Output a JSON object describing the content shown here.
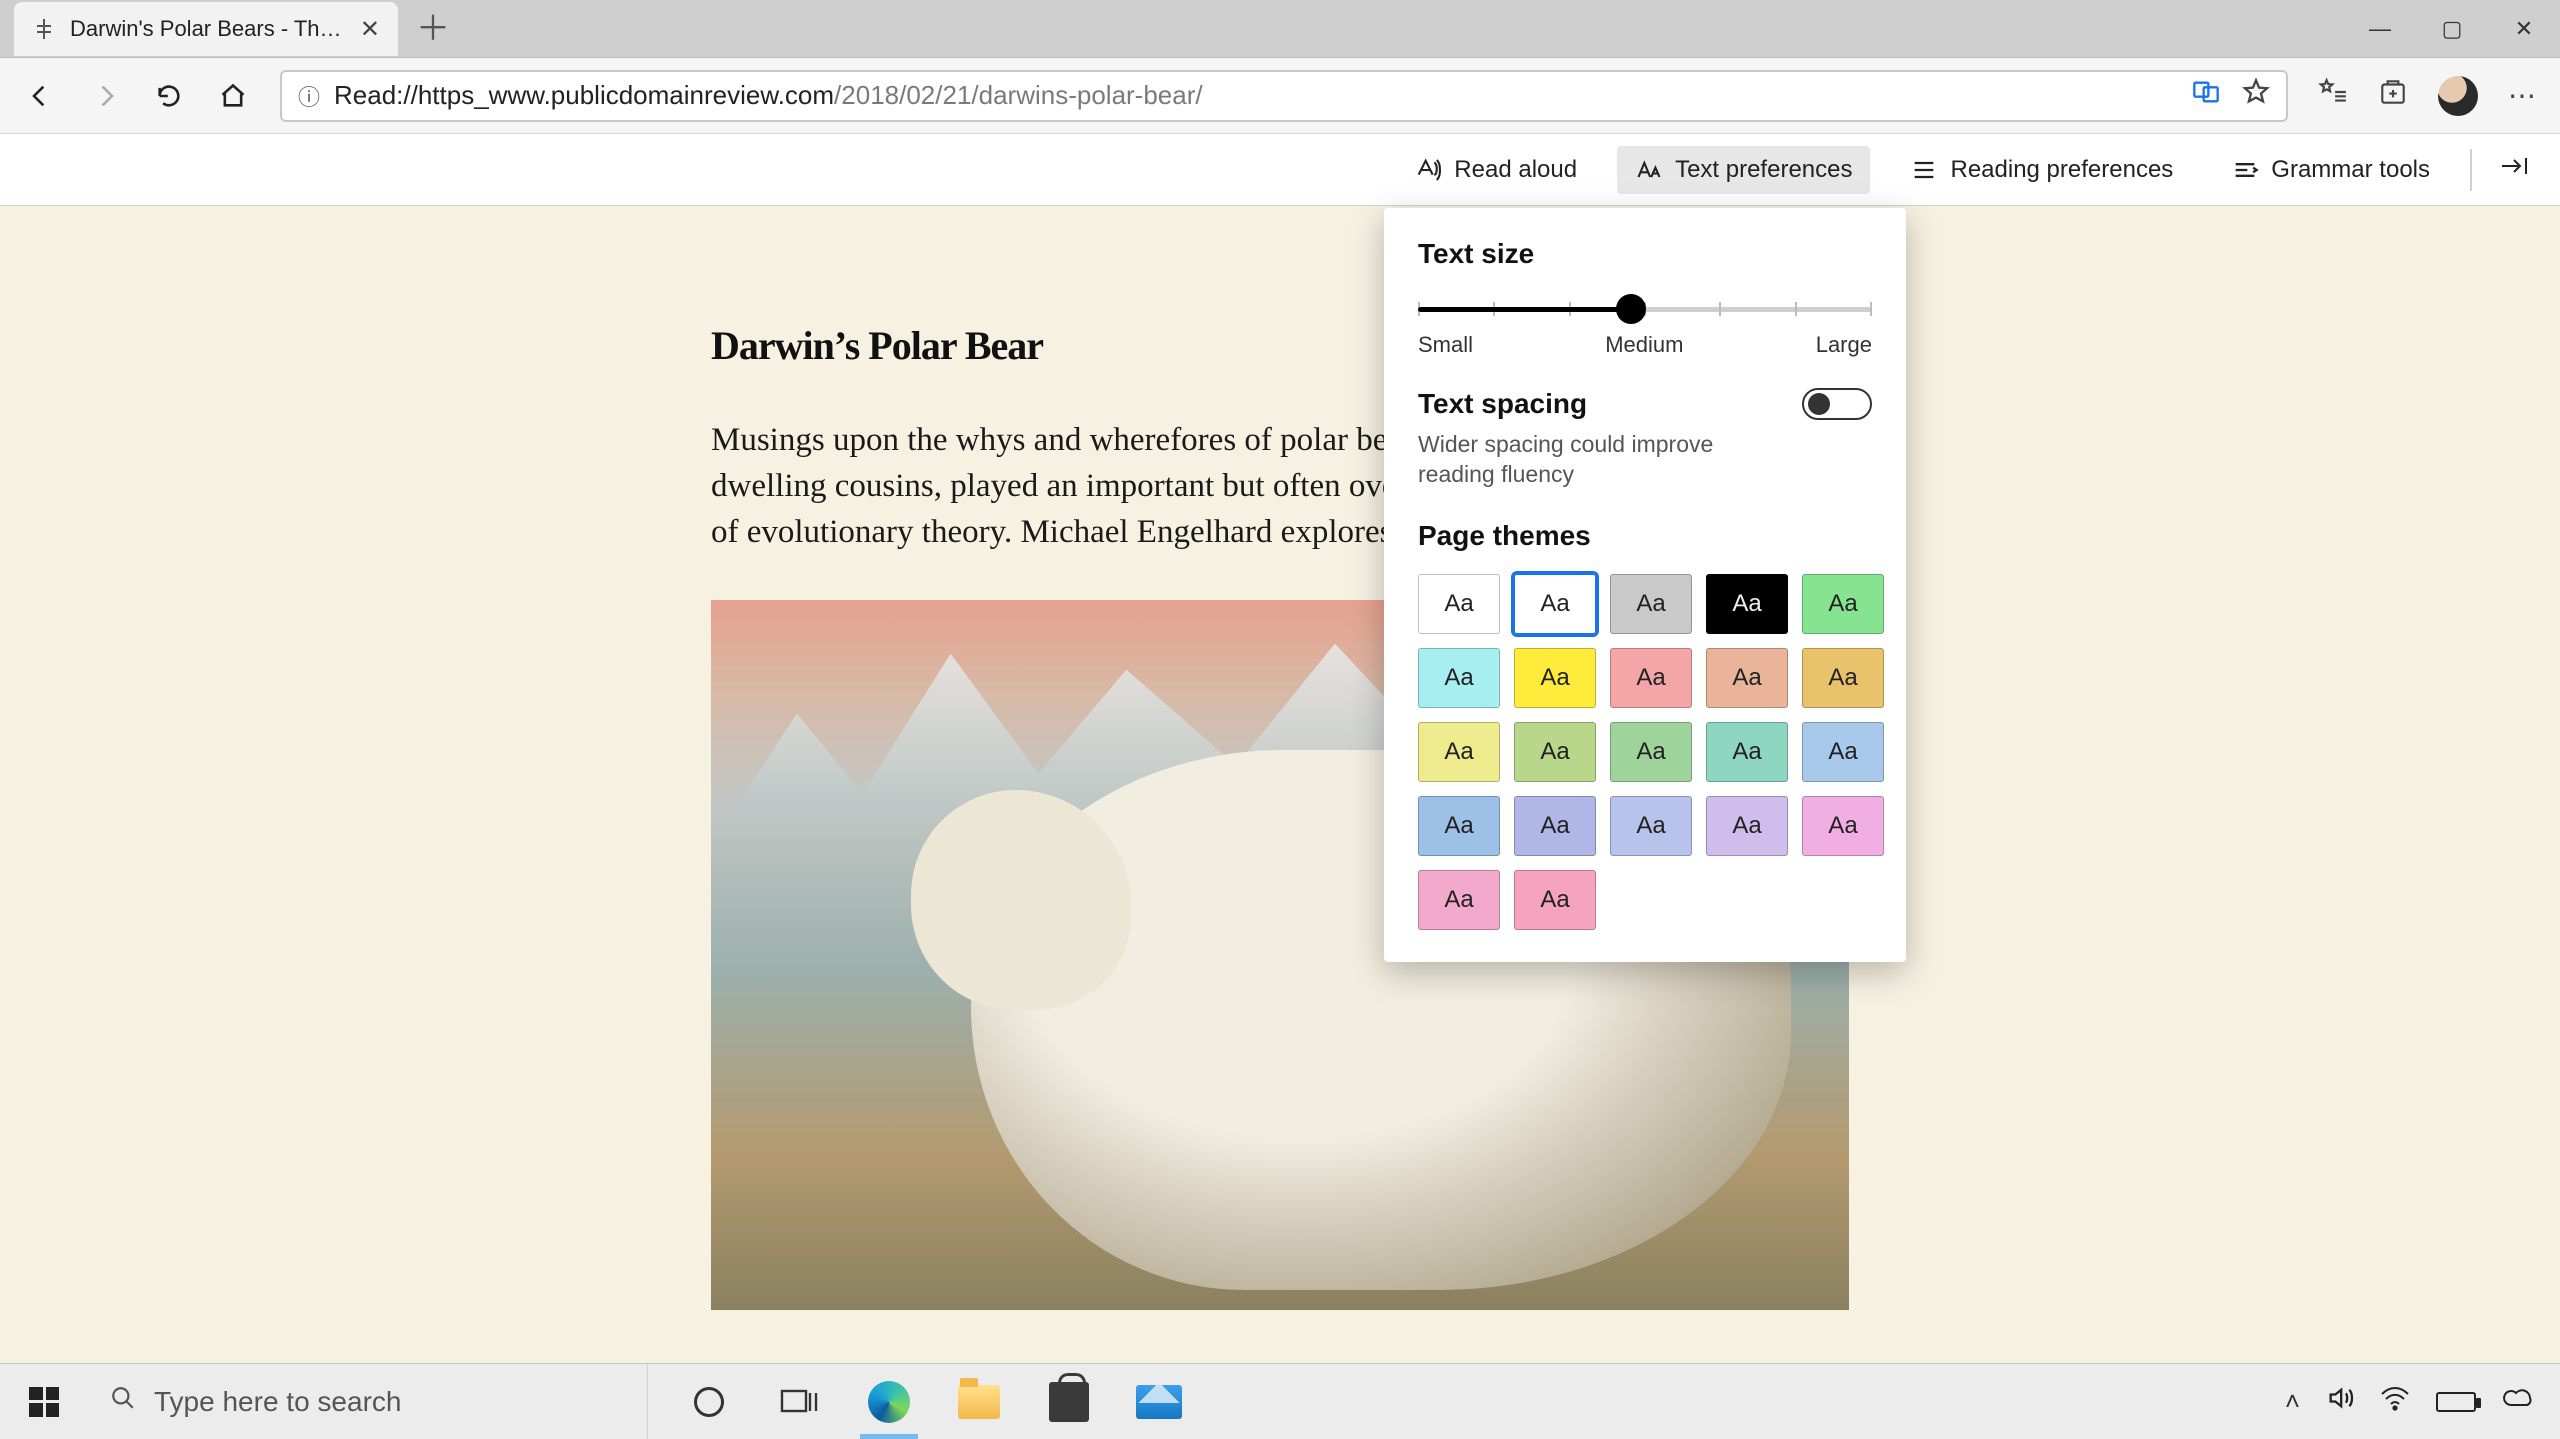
{
  "window": {
    "minimize": "—",
    "maximize": "▢",
    "close": "✕"
  },
  "tab": {
    "title": "Darwin's Polar Bears - The Pu…",
    "close": "✕",
    "new": "＋"
  },
  "nav": {
    "back": "←",
    "forward": "→",
    "refresh": "↻",
    "home": "⌂",
    "url_prefix": "Read://https_www.publicdomainreview.com",
    "url_path": "/2018/02/21/darwins-polar-bear/",
    "info": "ⓘ"
  },
  "addr_icons": {
    "translate": "⇄",
    "star": "☆"
  },
  "right_icons": {
    "favorites": "☆≡",
    "collections": "⊞",
    "more": "⋯"
  },
  "readerbar": {
    "read_aloud": "Read aloud",
    "text_prefs": "Text preferences",
    "reading_prefs": "Reading preferences",
    "grammar": "Grammar tools",
    "pin": "-⇥"
  },
  "article": {
    "title": "Darwin’s Polar Bear",
    "para": "Musings upon the whys and wherefores of polar bears, and their unlikely forest-dwelling cousins, played an important but often overlooked role in the development of evolutionary theory. Michael Engelhard explores."
  },
  "popover": {
    "text_size": "Text size",
    "small": "Small",
    "medium": "Medium",
    "large": "Large",
    "spacing_title": "Text spacing",
    "spacing_sub": "Wider spacing could improve reading fluency",
    "themes_title": "Page themes",
    "swatch_label": "Aa",
    "themes": [
      {
        "bg": "#ffffff",
        "fg": "#222222",
        "selected": false
      },
      {
        "bg": "#ffffff",
        "fg": "#222222",
        "selected": true
      },
      {
        "bg": "#c9c9c9",
        "fg": "#222222",
        "selected": false
      },
      {
        "bg": "#000000",
        "fg": "#eeeeee",
        "selected": false
      },
      {
        "bg": "#86e38f",
        "fg": "#222222",
        "selected": false
      },
      {
        "bg": "#a7eef1",
        "fg": "#222222",
        "selected": false
      },
      {
        "bg": "#ffeb3b",
        "fg": "#222222",
        "selected": false
      },
      {
        "bg": "#f4a6a6",
        "fg": "#222222",
        "selected": false
      },
      {
        "bg": "#e9b49a",
        "fg": "#222222",
        "selected": false
      },
      {
        "bg": "#e9c36b",
        "fg": "#222222",
        "selected": false
      },
      {
        "bg": "#eeea8e",
        "fg": "#222222",
        "selected": false
      },
      {
        "bg": "#b8d78a",
        "fg": "#222222",
        "selected": false
      },
      {
        "bg": "#9ed49c",
        "fg": "#222222",
        "selected": false
      },
      {
        "bg": "#8fd6c1",
        "fg": "#222222",
        "selected": false
      },
      {
        "bg": "#a9c9ec",
        "fg": "#222222",
        "selected": false
      },
      {
        "bg": "#9cc0e6",
        "fg": "#222222",
        "selected": false
      },
      {
        "bg": "#b0b7e6",
        "fg": "#222222",
        "selected": false
      },
      {
        "bg": "#b7c3ea",
        "fg": "#222222",
        "selected": false
      },
      {
        "bg": "#d0bdec",
        "fg": "#222222",
        "selected": false
      },
      {
        "bg": "#f1aee3",
        "fg": "#222222",
        "selected": false
      },
      {
        "bg": "#f3a9cc",
        "fg": "#222222",
        "selected": false
      },
      {
        "bg": "#f5a3bf",
        "fg": "#222222",
        "selected": false
      }
    ]
  },
  "taskbar": {
    "search_placeholder": "Type here to search",
    "search_icon": "🔍",
    "cortana": "○",
    "taskview": "▭▯"
  },
  "tray": {
    "chevron": "˄",
    "sound": "🔊",
    "wifi": "⌔",
    "cloud": "☁"
  }
}
